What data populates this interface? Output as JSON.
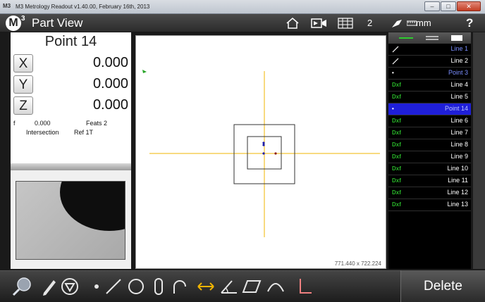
{
  "window": {
    "title": "M3 Metrology Readout  v1.40.00, February 16th, 2013",
    "app_icon": "M3",
    "minimize_glyph": "–",
    "maximize_glyph": "□",
    "close_glyph": "✕"
  },
  "header": {
    "logo": "M",
    "logo_superscript": "3",
    "view_title": "Part View",
    "feature_count": "2",
    "units": "mm",
    "help": "?",
    "icons": [
      "home-icon",
      "video-camera-icon",
      "table-icon",
      "probe-icon",
      "ruler-icon"
    ]
  },
  "dro": {
    "feature_title": "Point 14",
    "axes": [
      {
        "label": "X",
        "value": "0.000"
      },
      {
        "label": "Y",
        "value": "0.000"
      },
      {
        "label": "Z",
        "value": "0.000"
      }
    ],
    "f_label": "f",
    "f_value": "0.000",
    "feats": "Feats 2",
    "construction": "Intersection",
    "reference": "Ref 1T"
  },
  "canvas": {
    "coords": "771.440 x 722.224"
  },
  "feature_list": {
    "items": [
      {
        "icon": "line-icon",
        "icon_text": "",
        "label": "Line 1",
        "selected": false,
        "label_blue": true
      },
      {
        "icon": "line-icon",
        "icon_text": "",
        "label": "Line 2",
        "selected": false,
        "label_blue": false
      },
      {
        "icon": "point-icon",
        "icon_text": "•",
        "label": "Point 3",
        "selected": false,
        "label_blue": true
      },
      {
        "icon": "dxf-icon",
        "icon_text": "Dxf",
        "label": "Line 4",
        "selected": false,
        "label_blue": false
      },
      {
        "icon": "dxf-icon",
        "icon_text": "Dxf",
        "label": "Line 5",
        "selected": false,
        "label_blue": false
      },
      {
        "icon": "point-icon",
        "icon_text": "•",
        "label": "Point 14",
        "selected": true,
        "label_blue": false
      },
      {
        "icon": "dxf-icon",
        "icon_text": "Dxf",
        "label": "Line 6",
        "selected": false,
        "label_blue": false
      },
      {
        "icon": "dxf-icon",
        "icon_text": "Dxf",
        "label": "Line 7",
        "selected": false,
        "label_blue": false
      },
      {
        "icon": "dxf-icon",
        "icon_text": "Dxf",
        "label": "Line 8",
        "selected": false,
        "label_blue": false
      },
      {
        "icon": "dxf-icon",
        "icon_text": "Dxf",
        "label": "Line 9",
        "selected": false,
        "label_blue": false
      },
      {
        "icon": "dxf-icon",
        "icon_text": "Dxf",
        "label": "Line 10",
        "selected": false,
        "label_blue": false
      },
      {
        "icon": "dxf-icon",
        "icon_text": "Dxf",
        "label": "Line 11",
        "selected": false,
        "label_blue": false
      },
      {
        "icon": "dxf-icon",
        "icon_text": "Dxf",
        "label": "Line 12",
        "selected": false,
        "label_blue": false
      },
      {
        "icon": "dxf-icon",
        "icon_text": "Dxf",
        "label": "Line 13",
        "selected": false,
        "label_blue": false
      }
    ]
  },
  "toolbar": {
    "tools": [
      "magnifier-icon",
      "pen-icon",
      "auto-measure-icon",
      "point-tool-icon",
      "line-tool-icon",
      "circle-tool-icon",
      "slot-tool-icon",
      "arc-tool-icon",
      "distance-tool-icon",
      "angle-tool-icon",
      "plane-tool-icon",
      "curve-tool-icon",
      "skew-tool-icon"
    ],
    "delete_label": "Delete"
  },
  "colors": {
    "selected_row": "#1f1fd8",
    "crosshair": "#f0b400",
    "dxf_icon": "#28b428",
    "point_marker": "#1a1aa8"
  }
}
